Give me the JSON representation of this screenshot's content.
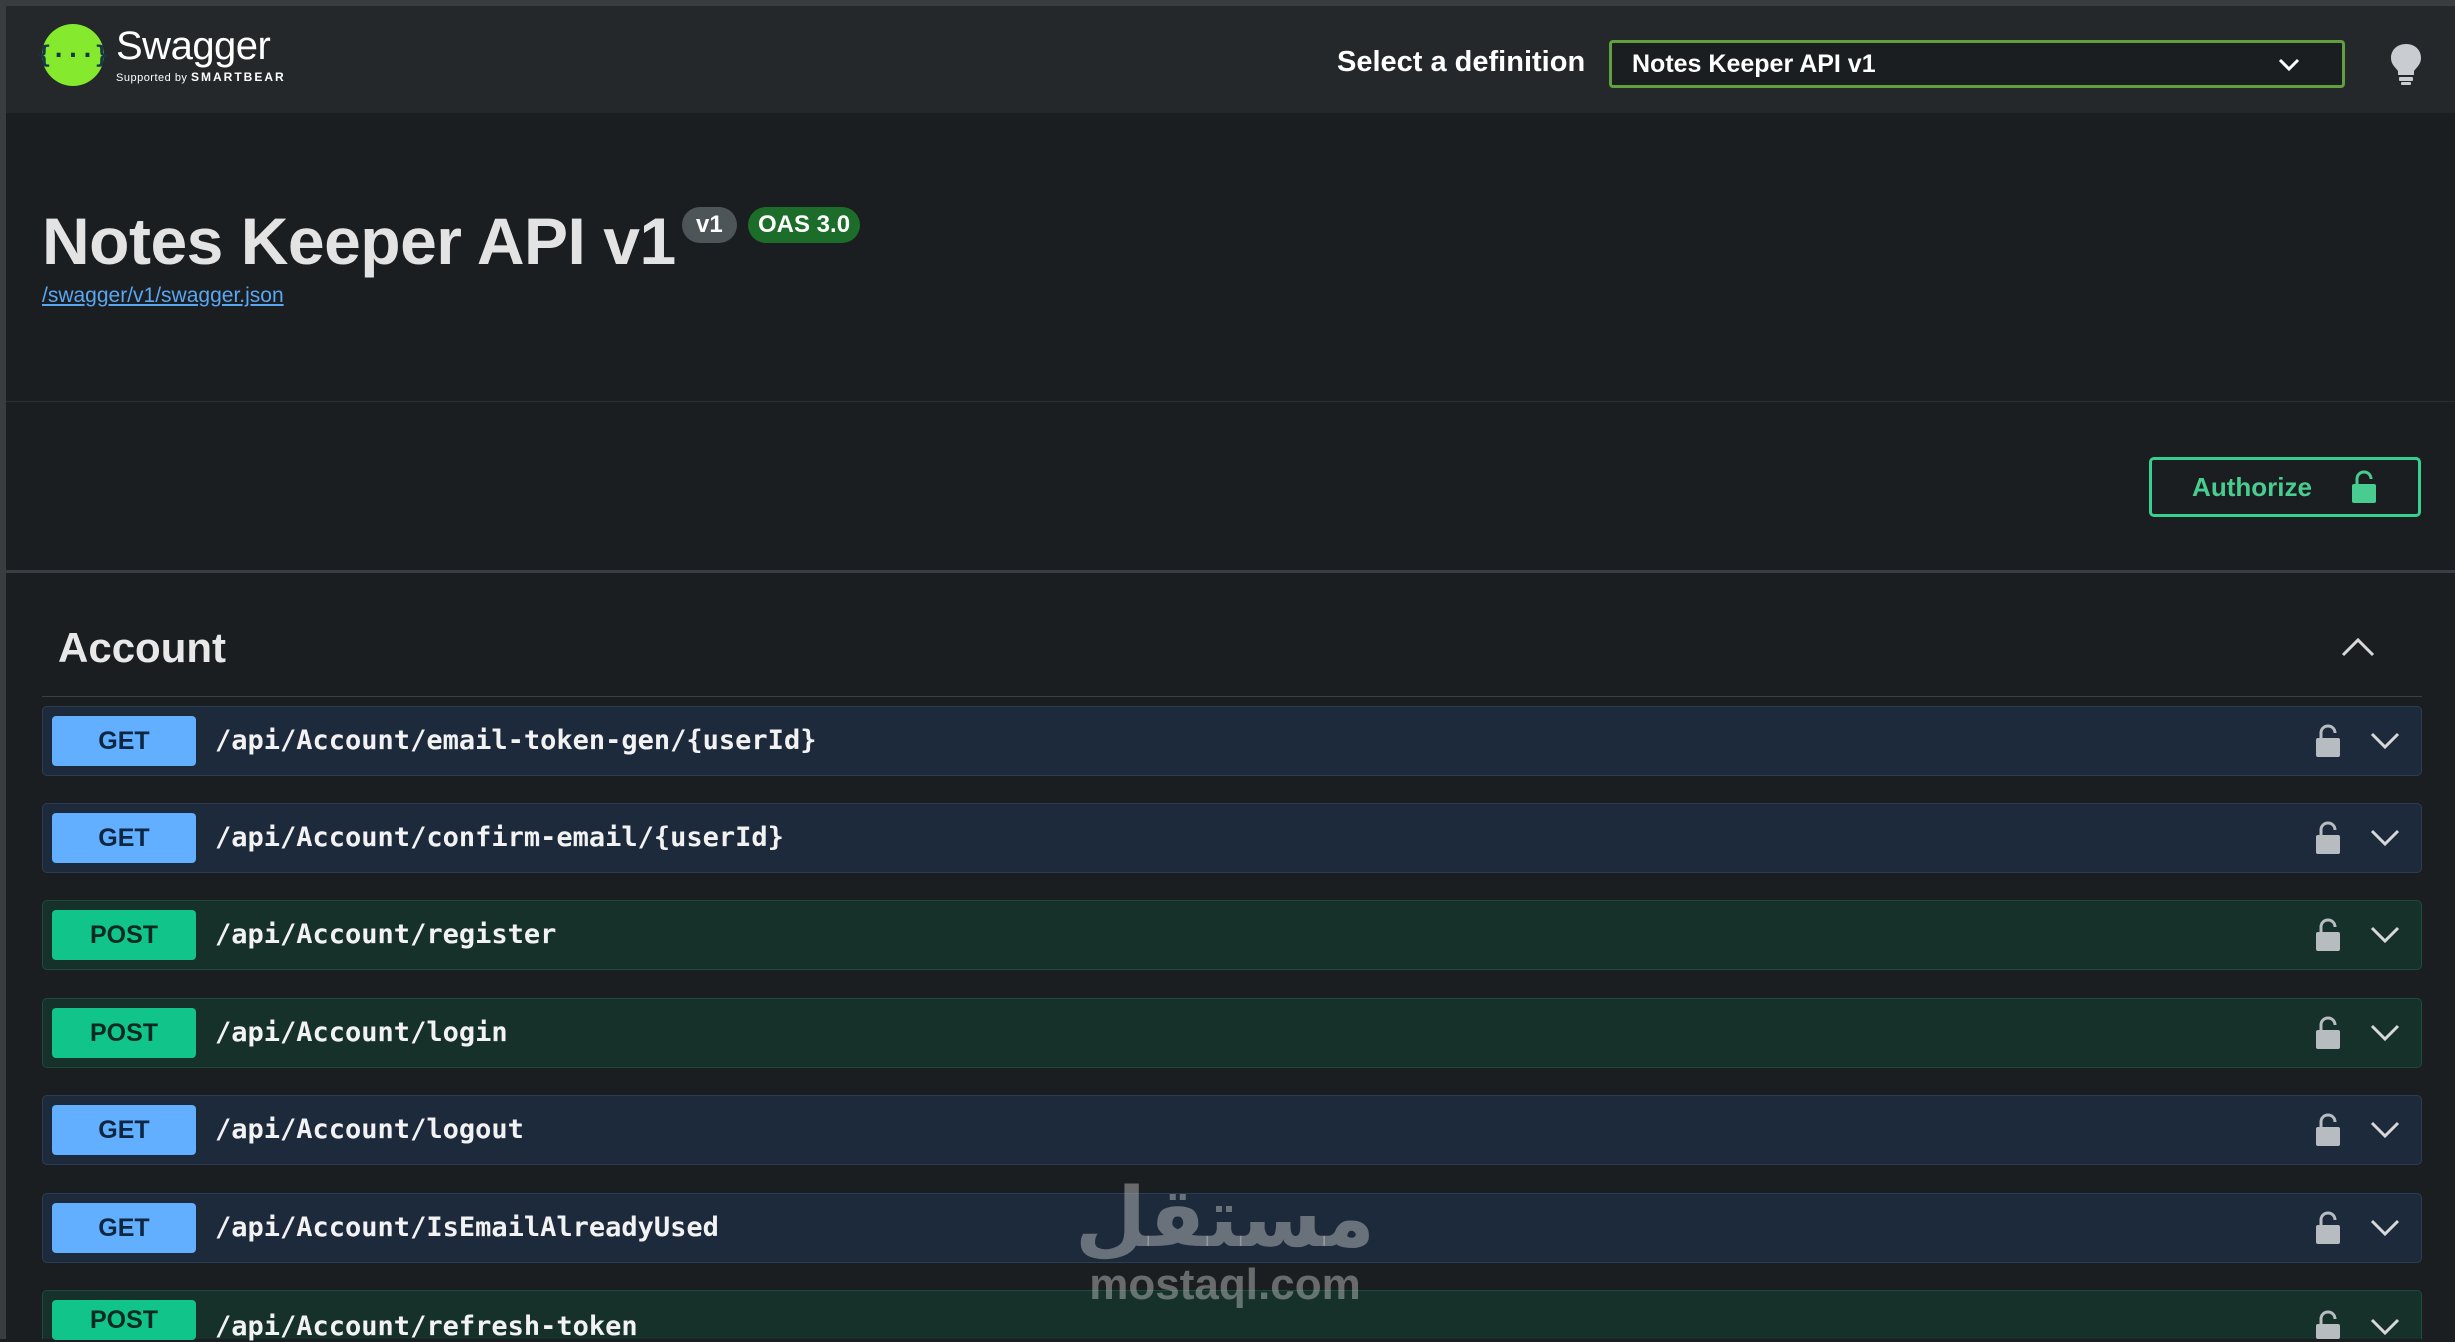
{
  "header": {
    "logo_name": "Swagger",
    "logo_sub_prefix": "Supported by",
    "logo_sub_brand": "SMARTBEAR",
    "definition_label": "Select a definition",
    "definition_selected": "Notes Keeper API v1"
  },
  "info": {
    "title": "Notes Keeper API v1",
    "version_badge": "v1",
    "oas_badge": "OAS 3.0",
    "spec_link": "/swagger/v1/swagger.json"
  },
  "authorize_label": "Authorize",
  "tag": {
    "name": "Account",
    "operations": [
      {
        "method": "GET",
        "path": "/api/Account/email-token-gen/{userId}"
      },
      {
        "method": "GET",
        "path": "/api/Account/confirm-email/{userId}"
      },
      {
        "method": "POST",
        "path": "/api/Account/register"
      },
      {
        "method": "POST",
        "path": "/api/Account/login"
      },
      {
        "method": "GET",
        "path": "/api/Account/logout"
      },
      {
        "method": "GET",
        "path": "/api/Account/IsEmailAlreadyUsed"
      },
      {
        "method": "POST",
        "path": "/api/Account/refresh-token"
      }
    ]
  },
  "watermark": {
    "arabic": "مستقل",
    "domain": "mostaql.com"
  },
  "colors": {
    "get": "#61affe",
    "post": "#10c48a",
    "authorize": "#49cc90",
    "logo": "#85ea2d"
  }
}
